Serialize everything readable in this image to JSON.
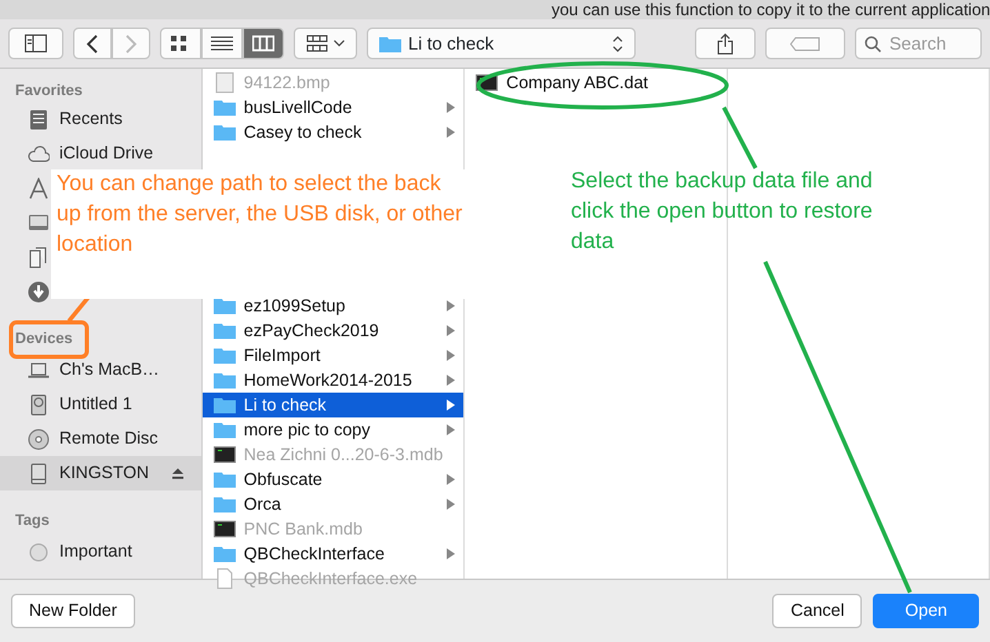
{
  "background_text": "you can use this function to copy it to the current application",
  "toolbar": {
    "nav": [
      {
        "kind": "back",
        "disabled": false
      },
      {
        "kind": "forward",
        "disabled": true
      }
    ],
    "view_modes": [
      {
        "kind": "icons",
        "selected": false
      },
      {
        "kind": "list",
        "selected": false
      },
      {
        "kind": "columns",
        "selected": true
      }
    ],
    "path": "Li to check",
    "search": {
      "placeholder": "Search"
    }
  },
  "sidebar": [
    {
      "title": "Favorites",
      "items": [
        {
          "kind": "recents",
          "label": "Recents",
          "selected": false
        },
        {
          "kind": "cloud",
          "label": "iCloud Drive",
          "selected": false
        },
        {
          "kind": "apps",
          "selected": false
        },
        {
          "kind": "desktop",
          "selected": false
        },
        {
          "kind": "documents",
          "selected": false
        },
        {
          "kind": "downloads",
          "selected": false
        }
      ]
    },
    {
      "title": "Devices",
      "items": [
        {
          "kind": "laptop",
          "label": "Ch's MacB…",
          "selected": false,
          "ejectable": false
        },
        {
          "kind": "disk",
          "label": "Untitled 1",
          "selected": false,
          "ejectable": false
        },
        {
          "kind": "disc",
          "label": "Remote Disc",
          "selected": false,
          "ejectable": false
        },
        {
          "kind": "drive",
          "label": "KINGSTON",
          "selected": true,
          "ejectable": true
        }
      ]
    },
    {
      "title": "Tags",
      "items": [
        {
          "kind": "tag",
          "label": "Important",
          "selected": false
        }
      ]
    }
  ],
  "columns": [
    [
      {
        "name": "94122.bmp",
        "kind": "image",
        "dimmed": true,
        "selected": false
      },
      {
        "name": "busLivellCode",
        "kind": "folder",
        "dimmed": false,
        "selected": false
      },
      {
        "name": "Casey to check",
        "kind": "folder",
        "dimmed": false,
        "selected": false
      },
      {
        "name": "ez1099Setup",
        "kind": "folder",
        "dimmed": false,
        "selected": false
      },
      {
        "name": "ezPayCheck2019",
        "kind": "folder",
        "dimmed": false,
        "selected": false
      },
      {
        "name": "FileImport",
        "kind": "folder",
        "dimmed": false,
        "selected": false
      },
      {
        "name": "HomeWork2014-2015",
        "kind": "folder",
        "dimmed": false,
        "selected": false
      },
      {
        "name": "Li to check",
        "kind": "folder",
        "dimmed": false,
        "selected": true
      },
      {
        "name": "more pic to copy",
        "kind": "folder",
        "dimmed": false,
        "selected": false
      },
      {
        "name": "Nea Zichni  0...20-6-3.mdb",
        "kind": "db",
        "dimmed": true,
        "selected": false
      },
      {
        "name": "Obfuscate",
        "kind": "folder",
        "dimmed": false,
        "selected": false
      },
      {
        "name": "Orca",
        "kind": "folder",
        "dimmed": false,
        "selected": false
      },
      {
        "name": "PNC Bank.mdb",
        "kind": "db",
        "dimmed": true,
        "selected": false
      },
      {
        "name": "QBCheckInterface",
        "kind": "folder",
        "dimmed": false,
        "selected": false
      },
      {
        "name": "QBCheckInterface.exe",
        "kind": "doc",
        "dimmed": true,
        "selected": false
      }
    ],
    [
      {
        "name": "Company ABC.dat",
        "kind": "db",
        "dimmed": false,
        "selected": false
      }
    ]
  ],
  "callouts": [
    {
      "text": "You can change path to select the back up from the server, the USB disk, or other location",
      "color": "#ff7f27"
    },
    {
      "text": "Select the backup data file and click the open button to restore data",
      "color": "#22b14c"
    }
  ],
  "buttons": [
    {
      "label": "New Folder",
      "kind": "secondary"
    },
    {
      "label": "Cancel",
      "kind": "secondary"
    },
    {
      "label": "Open",
      "kind": "primary"
    }
  ]
}
